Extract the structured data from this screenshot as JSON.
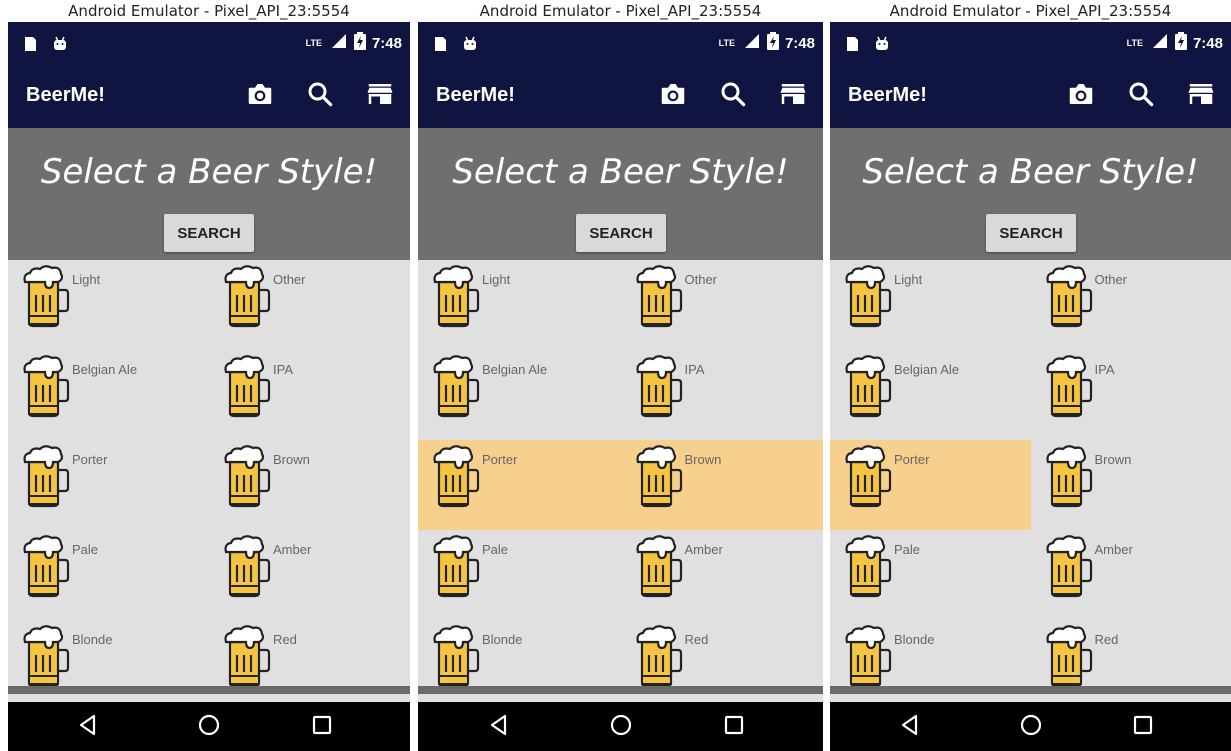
{
  "window_title": "Android Emulator - Pixel_API_23:5554",
  "status": {
    "network": "LTE",
    "time": "7:48"
  },
  "app": {
    "title": "BeerMe!"
  },
  "hero": {
    "heading": "Select a Beer Style!",
    "search_label": "SEARCH"
  },
  "styles": [
    "Light",
    "Other",
    "Belgian Ale",
    "IPA",
    "Porter",
    "Brown",
    "Pale",
    "Amber",
    "Blonde",
    "Red"
  ],
  "panels": [
    {
      "highlighted": []
    },
    {
      "highlighted": [
        "Porter",
        "Brown"
      ]
    },
    {
      "highlighted": [
        "Porter"
      ]
    }
  ],
  "colors": {
    "appbar": "#0f1540",
    "hero": "#6f6f6f",
    "list_bg": "#e0e0e0",
    "highlight": "#f7d08d",
    "mug_body": "#f5c542"
  }
}
